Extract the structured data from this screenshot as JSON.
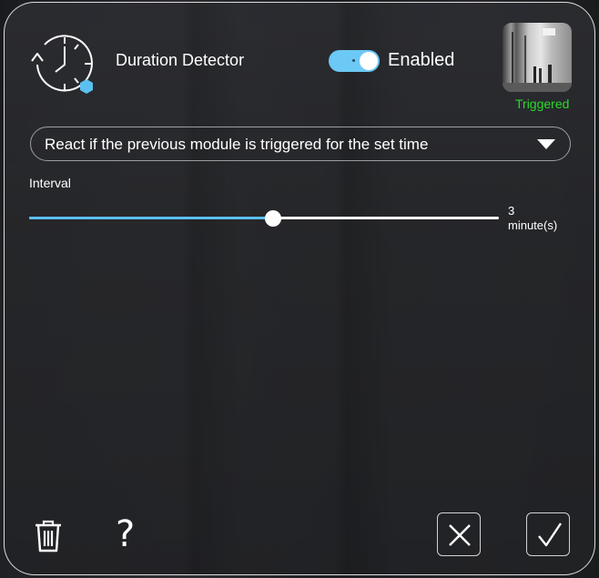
{
  "module": {
    "title": "Duration Detector",
    "icon": "clock-timer-icon",
    "badge_color": "#5bc0f0"
  },
  "toggle": {
    "label": "Enabled",
    "state": true,
    "color": "#6cc8f5"
  },
  "camera": {
    "thumbnail_icon": "camera-snapshot",
    "status": "Triggered",
    "status_color": "#2bd92b"
  },
  "reaction": {
    "selected": "React if the previous module is triggered for the set time"
  },
  "interval": {
    "label": "Interval",
    "value": "3",
    "unit": "minute(s)",
    "fraction": 0.52,
    "accent": "#5bc0f0"
  },
  "footer": {
    "delete_icon": "trash-icon",
    "help_label": "?",
    "cancel_icon": "close-icon",
    "confirm_icon": "check-icon"
  }
}
